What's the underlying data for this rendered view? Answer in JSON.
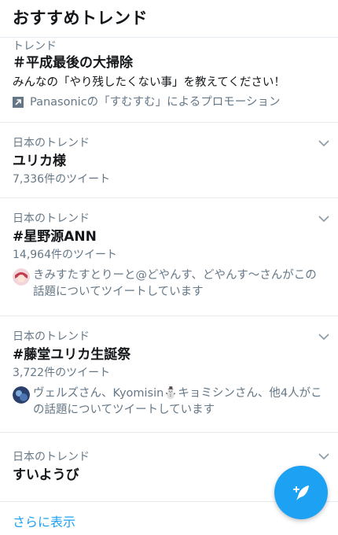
{
  "header": {
    "title": "おすすめトレンド"
  },
  "trends": [
    {
      "context": "トレンド",
      "name": "＃平成最後の大掃除",
      "description": "みんなの「やり残したくない事」を教えてください！",
      "promoted": "Panasonicの「すむすむ」によるプロモーション"
    },
    {
      "context": "日本のトレンド",
      "name": "ユリカ様",
      "count": "7,336件のツイート"
    },
    {
      "context": "日本のトレンド",
      "name": "#星野源ANN",
      "count": "14,964件のツイート",
      "social": "きみすたすとりーと@どやんす、どやんす〜さんがこの話題についてツイートしています"
    },
    {
      "context": "日本のトレンド",
      "name": "#藤堂ユリカ生誕祭",
      "count": "3,722件のツイート",
      "social": "ヴェルズさん、Kyomisin⛄キョミシンさん、他4人がこの話題についてツイートしています"
    },
    {
      "context": "日本のトレンド",
      "name": "すいようび"
    }
  ],
  "show_more": "さらに表示",
  "icons": {
    "chevron": "chevron-down-icon",
    "promoted": "promoted-arrow-icon",
    "compose": "compose-tweet-icon"
  },
  "colors": {
    "accent": "#1da1f2",
    "secondary_text": "#657786",
    "divider": "#e6ecf0"
  }
}
